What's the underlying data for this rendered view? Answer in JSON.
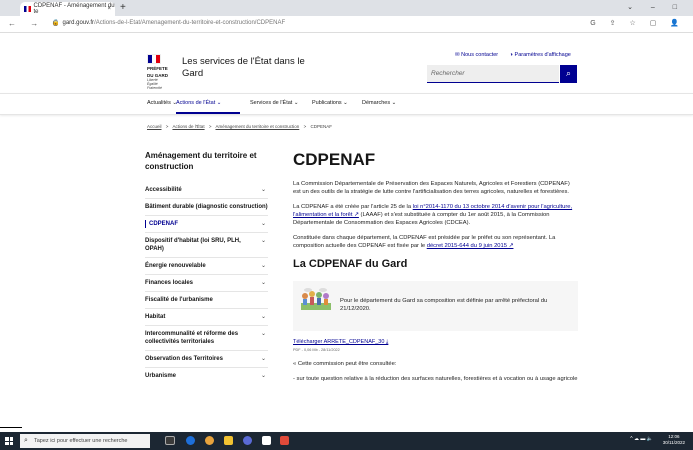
{
  "browser": {
    "tab_title": "CDPENAF - Aménagement du te",
    "tab_close": "×",
    "new_tab": "+",
    "url_host": "gard.gouv.fr",
    "url_path": "/Actions-de-l-Etat/Amenagement-du-territoire-et-construction/CDPENAF",
    "window_controls": "⌄ – □",
    "nav_buttons": "← → C"
  },
  "header": {
    "logo_line1": "PRÉFETE",
    "logo_line2": "DU GARD",
    "logo_motto": "Liberté Égalité Fraternité",
    "site_title_line1": "Les services de l'État dans le",
    "site_title_line2": "Gard",
    "contact_link": "✉ Nous contacter",
    "display_link": "◑ Paramètres d'affichage",
    "search_placeholder": "Rechercher",
    "search_icon": "⌕"
  },
  "mainnav": {
    "items": [
      {
        "label": "Actualités ⌄"
      },
      {
        "label": "Actions de l'État ⌄"
      },
      {
        "label": "Services de l'État ⌄"
      },
      {
        "label": "Publications ⌄"
      },
      {
        "label": "Démarches ⌄"
      }
    ]
  },
  "breadcrumb": {
    "items": [
      "Accueil",
      ">",
      "Actions de l'État",
      ">",
      "Aménagement du territoire et construction",
      ">",
      "CDPENAF"
    ]
  },
  "sidebar": {
    "title": "Aménagement du territoire et construction",
    "items": [
      {
        "label": "Accessibilité",
        "chevron": "⌄"
      },
      {
        "label": "Bâtiment durable (diagnostic construction)",
        "chevron": ""
      },
      {
        "label": "CDPENAF",
        "chevron": "⌄"
      },
      {
        "label": "Dispositif d'habitat (loi SRU, PLH, OPAH)",
        "chevron": "⌄"
      },
      {
        "label": "Énergie renouvelable",
        "chevron": "⌄"
      },
      {
        "label": "Finances locales",
        "chevron": "⌄"
      },
      {
        "label": "Fiscalité de l'urbanisme",
        "chevron": ""
      },
      {
        "label": "Habitat",
        "chevron": "⌄"
      },
      {
        "label": "Intercommunalité et réforme des collectivités territoriales",
        "chevron": "⌄"
      },
      {
        "label": "Observation des Territoires",
        "chevron": "⌄"
      },
      {
        "label": "Urbanisme",
        "chevron": "⌄"
      }
    ]
  },
  "content": {
    "title": "CDPENAF",
    "p1": "La Commission Départementale de Préservation des Espaces Naturels, Agricoles et Forestiers (CDPENAF) est un des outils de la stratégie de lutte contre l'artificialisation des terres agricoles, naturelles et forestières.",
    "p2_a": "La CDPENAF a été créée par l'article 25 de la ",
    "p2_link": "loi n°2014-1170 du 13 octobre 2014 d'avenir pour l'agriculture, l'alimentation et la forêt ↗",
    "p2_b": " (LAAAF) et s'est substituée à compter du 1er août 2015, à la Commission Départementale de Consommation des Espaces Agricoles (CDCEA).",
    "p3_a": "Constituée dans chaque département, la CDPENAF est présidée par le préfet ou son représentant. La composition actuelle des CDPENAF est fixée par le ",
    "p3_link": "décret 2015-644 du 9 juin 2015 ↗",
    "h2": "La CDPENAF du Gard",
    "card_text": "Pour le département du Gard sa composition est définie par arrêté préfectoral du 21/12/2020.",
    "download_label": "Télécharger ARRETE_CDPENAF_30 ⤓",
    "download_meta": "PDF - 0,06 Mb - 28/11/2022",
    "quote": "« Cette commission peut être consultée:",
    "bullet": "- sur toute question relative à la réduction des surfaces naturelles, forestières et à vocation ou à usage agricole"
  },
  "taskbar": {
    "search_placeholder": "Tapez ici pour effectuer une recherche",
    "time": "12:06",
    "date": "30/11/2022",
    "tray": "^ ☁ ▬ 🔈"
  },
  "colors": {
    "primary_blue": "#000091",
    "marianne_red": "#e1000f",
    "taskbar": "#1c2733"
  }
}
